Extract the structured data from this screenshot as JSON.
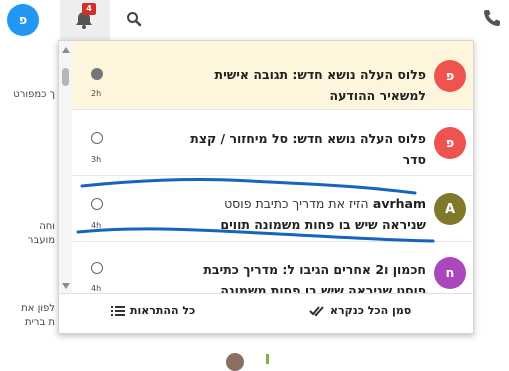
{
  "topbar": {
    "user_initial": "פ",
    "bell_count": "4",
    "icons": [
      "bell-icon",
      "search-icon",
      "phone-icon"
    ]
  },
  "background": {
    "lines": [
      "ך כמפורט",
      "וחה",
      "מועבר",
      "לפון את",
      "ת ברית"
    ]
  },
  "notifications": [
    {
      "avatar": "פ",
      "avatar_color": "#ef5350",
      "line1": "פלוס העלה נושא חדש: תגובה אישית",
      "line2": "למשאיר ההודעה",
      "time": "2h",
      "unread": true
    },
    {
      "avatar": "פ",
      "avatar_color": "#ef5350",
      "line1": "פלוס העלה נושא חדש: סל מיחזור / קצת",
      "line2": "סדר",
      "time": "3h",
      "unread": false
    },
    {
      "avatar": "A",
      "avatar_color": "#7e7a2a",
      "actor": "avrham",
      "line1_rest": "הזיז את מדריך כתיבת פוסט",
      "line2": "שניראה שיש בו פחות משמונה תווים",
      "time": "4h",
      "unread": false
    },
    {
      "avatar": "ח",
      "avatar_color": "#ab47bc",
      "line1": "חכמון ו2 אחרים הגיבו ל: מדריך כתיבת",
      "line2": "פוסט שניראה שיש בו פחות משמונה",
      "time": "4h",
      "unread": false
    }
  ],
  "footer": {
    "all_notifications": "כל ההתראות",
    "mark_all_read": "סמן הכל כנקרא"
  },
  "colors": {
    "accent": "#2196f3",
    "unread_bg": "#fdf5dc",
    "badge": "#d32f2f",
    "scribble": "#1565c0"
  }
}
